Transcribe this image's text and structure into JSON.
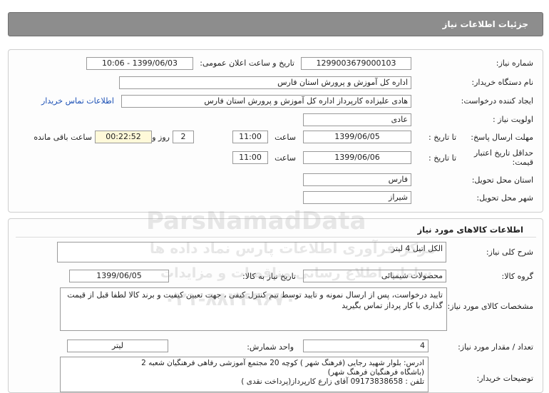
{
  "header": {
    "title": "جزئیات اطلاعات نیاز"
  },
  "info": {
    "need_number_label": "شماره نیاز:",
    "need_number": "1299003679000103",
    "announce_label": "تاریخ و ساعت اعلان عمومی:",
    "announce_value": "1399/06/03 - 10:06",
    "buyer_label": "نام دستگاه خریدار:",
    "buyer_value": "اداره کل آموزش و پرورش استان فارس",
    "creator_label": "ایجاد کننده درخواست:",
    "creator_value": "هادی علیزاده کارپرداز اداره کل آموزش و پرورش استان فارس",
    "contact_link": "اطلاعات تماس خریدار",
    "priority_label": "اولویت نیاز :",
    "priority_value": "عادی",
    "reply_deadline_label": "مهلت ارسال پاسخ:",
    "until_date_label": "تا تاریخ :",
    "reply_date": "1399/06/05",
    "time_label": "ساعت",
    "reply_time": "11:00",
    "days_value": "2",
    "days_label": "روز و",
    "remaining_time": "00:22:52",
    "remaining_label": "ساعت باقی مانده",
    "price_validity_label": "حداقل تاریخ اعتبار قیمت:",
    "price_until_label": "تا تاریخ :",
    "price_date": "1399/06/06",
    "price_time_label": "ساعت",
    "price_time": "11:00",
    "province_label": "استان محل تحویل:",
    "province_value": "فارس",
    "city_label": "شهر محل تحویل:",
    "city_value": "شیراز"
  },
  "goods": {
    "section_title": "اطلاعات کالاهای مورد نیاز",
    "summary_label": "شرح کلی نیاز:",
    "summary_value": "الکل اتیل 4 لیتر",
    "group_label": "گروه کالا:",
    "group_value": "محصولات شیمیائی",
    "need_date_label": "تاریخ نیاز به کالا:",
    "need_date": "1399/06/05",
    "spec_label": "مشخصات کالای مورد نیاز:",
    "spec_value": "تایید درخواست، پس از ارسال نمونه و تایید توسط تیم کنترل کیفی ، جهت تعیین کیفیت و برند کالا لطفا قبل از قیمت گذاری با کار پرداز تماس بگیرید",
    "qty_label": "تعداد / مقدار مورد نیاز:",
    "qty_value": "4",
    "unit_label": "واحد شمارش:",
    "unit_value": "لیتر",
    "buyer_notes_label": "توضیحات خریدار:",
    "address_line1": "ادرس: بلوار شهید رجایی (فرهنگ شهر ) کوچه 20  مجتمع آموزشی رفاهی فرهنگیان شعبه 2",
    "address_line2": "(باشگاه فرهنگیان فرهنگ شهر)",
    "address_line3": "تلفن : 09173838658 آقای زارع  کارپرداز(پرداخت نقدی  )"
  },
  "watermark": {
    "brand": "ParsNamadData",
    "line1": "مرکز فرآوری اطلاعات پارس نماد داده ها",
    "line2": "سامانه اطلاع رسانی مناقصات و مزایدات",
    "phone": "۰۲۱-۸۸۳۴۹۶۷۰"
  }
}
